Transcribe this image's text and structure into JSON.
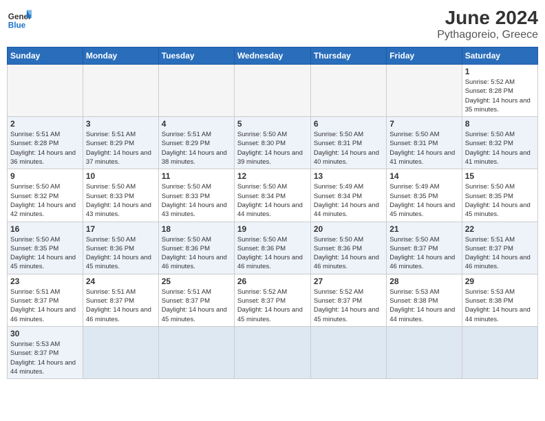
{
  "header": {
    "logo_general": "General",
    "logo_blue": "Blue",
    "month_year": "June 2024",
    "location": "Pythagoreio, Greece"
  },
  "days_of_week": [
    "Sunday",
    "Monday",
    "Tuesday",
    "Wednesday",
    "Thursday",
    "Friday",
    "Saturday"
  ],
  "weeks": [
    {
      "shade": "light",
      "days": [
        {
          "num": "",
          "info": ""
        },
        {
          "num": "",
          "info": ""
        },
        {
          "num": "",
          "info": ""
        },
        {
          "num": "",
          "info": ""
        },
        {
          "num": "",
          "info": ""
        },
        {
          "num": "",
          "info": ""
        },
        {
          "num": "1",
          "info": "Sunrise: 5:52 AM\nSunset: 8:28 PM\nDaylight: 14 hours and 35 minutes."
        }
      ]
    },
    {
      "shade": "dark",
      "days": [
        {
          "num": "2",
          "info": "Sunrise: 5:51 AM\nSunset: 8:28 PM\nDaylight: 14 hours and 36 minutes."
        },
        {
          "num": "3",
          "info": "Sunrise: 5:51 AM\nSunset: 8:29 PM\nDaylight: 14 hours and 37 minutes."
        },
        {
          "num": "4",
          "info": "Sunrise: 5:51 AM\nSunset: 8:29 PM\nDaylight: 14 hours and 38 minutes."
        },
        {
          "num": "5",
          "info": "Sunrise: 5:50 AM\nSunset: 8:30 PM\nDaylight: 14 hours and 39 minutes."
        },
        {
          "num": "6",
          "info": "Sunrise: 5:50 AM\nSunset: 8:31 PM\nDaylight: 14 hours and 40 minutes."
        },
        {
          "num": "7",
          "info": "Sunrise: 5:50 AM\nSunset: 8:31 PM\nDaylight: 14 hours and 41 minutes."
        },
        {
          "num": "8",
          "info": "Sunrise: 5:50 AM\nSunset: 8:32 PM\nDaylight: 14 hours and 41 minutes."
        }
      ]
    },
    {
      "shade": "light",
      "days": [
        {
          "num": "9",
          "info": "Sunrise: 5:50 AM\nSunset: 8:32 PM\nDaylight: 14 hours and 42 minutes."
        },
        {
          "num": "10",
          "info": "Sunrise: 5:50 AM\nSunset: 8:33 PM\nDaylight: 14 hours and 43 minutes."
        },
        {
          "num": "11",
          "info": "Sunrise: 5:50 AM\nSunset: 8:33 PM\nDaylight: 14 hours and 43 minutes."
        },
        {
          "num": "12",
          "info": "Sunrise: 5:50 AM\nSunset: 8:34 PM\nDaylight: 14 hours and 44 minutes."
        },
        {
          "num": "13",
          "info": "Sunrise: 5:49 AM\nSunset: 8:34 PM\nDaylight: 14 hours and 44 minutes."
        },
        {
          "num": "14",
          "info": "Sunrise: 5:49 AM\nSunset: 8:35 PM\nDaylight: 14 hours and 45 minutes."
        },
        {
          "num": "15",
          "info": "Sunrise: 5:50 AM\nSunset: 8:35 PM\nDaylight: 14 hours and 45 minutes."
        }
      ]
    },
    {
      "shade": "dark",
      "days": [
        {
          "num": "16",
          "info": "Sunrise: 5:50 AM\nSunset: 8:35 PM\nDaylight: 14 hours and 45 minutes."
        },
        {
          "num": "17",
          "info": "Sunrise: 5:50 AM\nSunset: 8:36 PM\nDaylight: 14 hours and 45 minutes."
        },
        {
          "num": "18",
          "info": "Sunrise: 5:50 AM\nSunset: 8:36 PM\nDaylight: 14 hours and 46 minutes."
        },
        {
          "num": "19",
          "info": "Sunrise: 5:50 AM\nSunset: 8:36 PM\nDaylight: 14 hours and 46 minutes."
        },
        {
          "num": "20",
          "info": "Sunrise: 5:50 AM\nSunset: 8:36 PM\nDaylight: 14 hours and 46 minutes."
        },
        {
          "num": "21",
          "info": "Sunrise: 5:50 AM\nSunset: 8:37 PM\nDaylight: 14 hours and 46 minutes."
        },
        {
          "num": "22",
          "info": "Sunrise: 5:51 AM\nSunset: 8:37 PM\nDaylight: 14 hours and 46 minutes."
        }
      ]
    },
    {
      "shade": "light",
      "days": [
        {
          "num": "23",
          "info": "Sunrise: 5:51 AM\nSunset: 8:37 PM\nDaylight: 14 hours and 46 minutes."
        },
        {
          "num": "24",
          "info": "Sunrise: 5:51 AM\nSunset: 8:37 PM\nDaylight: 14 hours and 46 minutes."
        },
        {
          "num": "25",
          "info": "Sunrise: 5:51 AM\nSunset: 8:37 PM\nDaylight: 14 hours and 45 minutes."
        },
        {
          "num": "26",
          "info": "Sunrise: 5:52 AM\nSunset: 8:37 PM\nDaylight: 14 hours and 45 minutes."
        },
        {
          "num": "27",
          "info": "Sunrise: 5:52 AM\nSunset: 8:37 PM\nDaylight: 14 hours and 45 minutes."
        },
        {
          "num": "28",
          "info": "Sunrise: 5:53 AM\nSunset: 8:38 PM\nDaylight: 14 hours and 44 minutes."
        },
        {
          "num": "29",
          "info": "Sunrise: 5:53 AM\nSunset: 8:38 PM\nDaylight: 14 hours and 44 minutes."
        }
      ]
    },
    {
      "shade": "dark",
      "days": [
        {
          "num": "30",
          "info": "Sunrise: 5:53 AM\nSunset: 8:37 PM\nDaylight: 14 hours and 44 minutes."
        },
        {
          "num": "",
          "info": ""
        },
        {
          "num": "",
          "info": ""
        },
        {
          "num": "",
          "info": ""
        },
        {
          "num": "",
          "info": ""
        },
        {
          "num": "",
          "info": ""
        },
        {
          "num": "",
          "info": ""
        }
      ]
    }
  ]
}
